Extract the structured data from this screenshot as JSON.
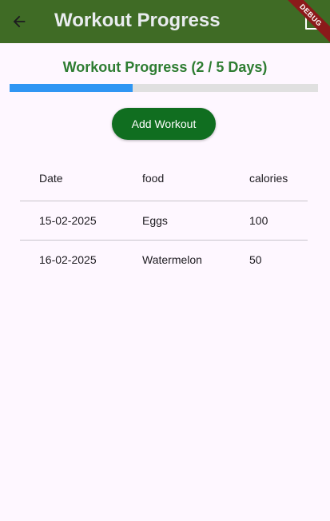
{
  "app_bar": {
    "title": "Workout Progress",
    "back_icon": "arrow-back-icon",
    "action_icon": "file-icon",
    "background_color": "#3f6b25",
    "debug_banner": "DEBUG"
  },
  "progress": {
    "title": "Workout Progress (2 / 5 Days)",
    "completed": 2,
    "total": 5,
    "fraction": 0.4,
    "fill_color": "#2f96f3",
    "track_color": "#e0e0e0"
  },
  "add_button": {
    "label": "Add Workout",
    "color": "#106e20"
  },
  "table": {
    "columns": [
      "Date",
      "food",
      "calories"
    ],
    "rows": [
      [
        "15-02-2025",
        "Eggs",
        "100"
      ],
      [
        "16-02-2025",
        "Watermelon",
        "50"
      ]
    ]
  }
}
